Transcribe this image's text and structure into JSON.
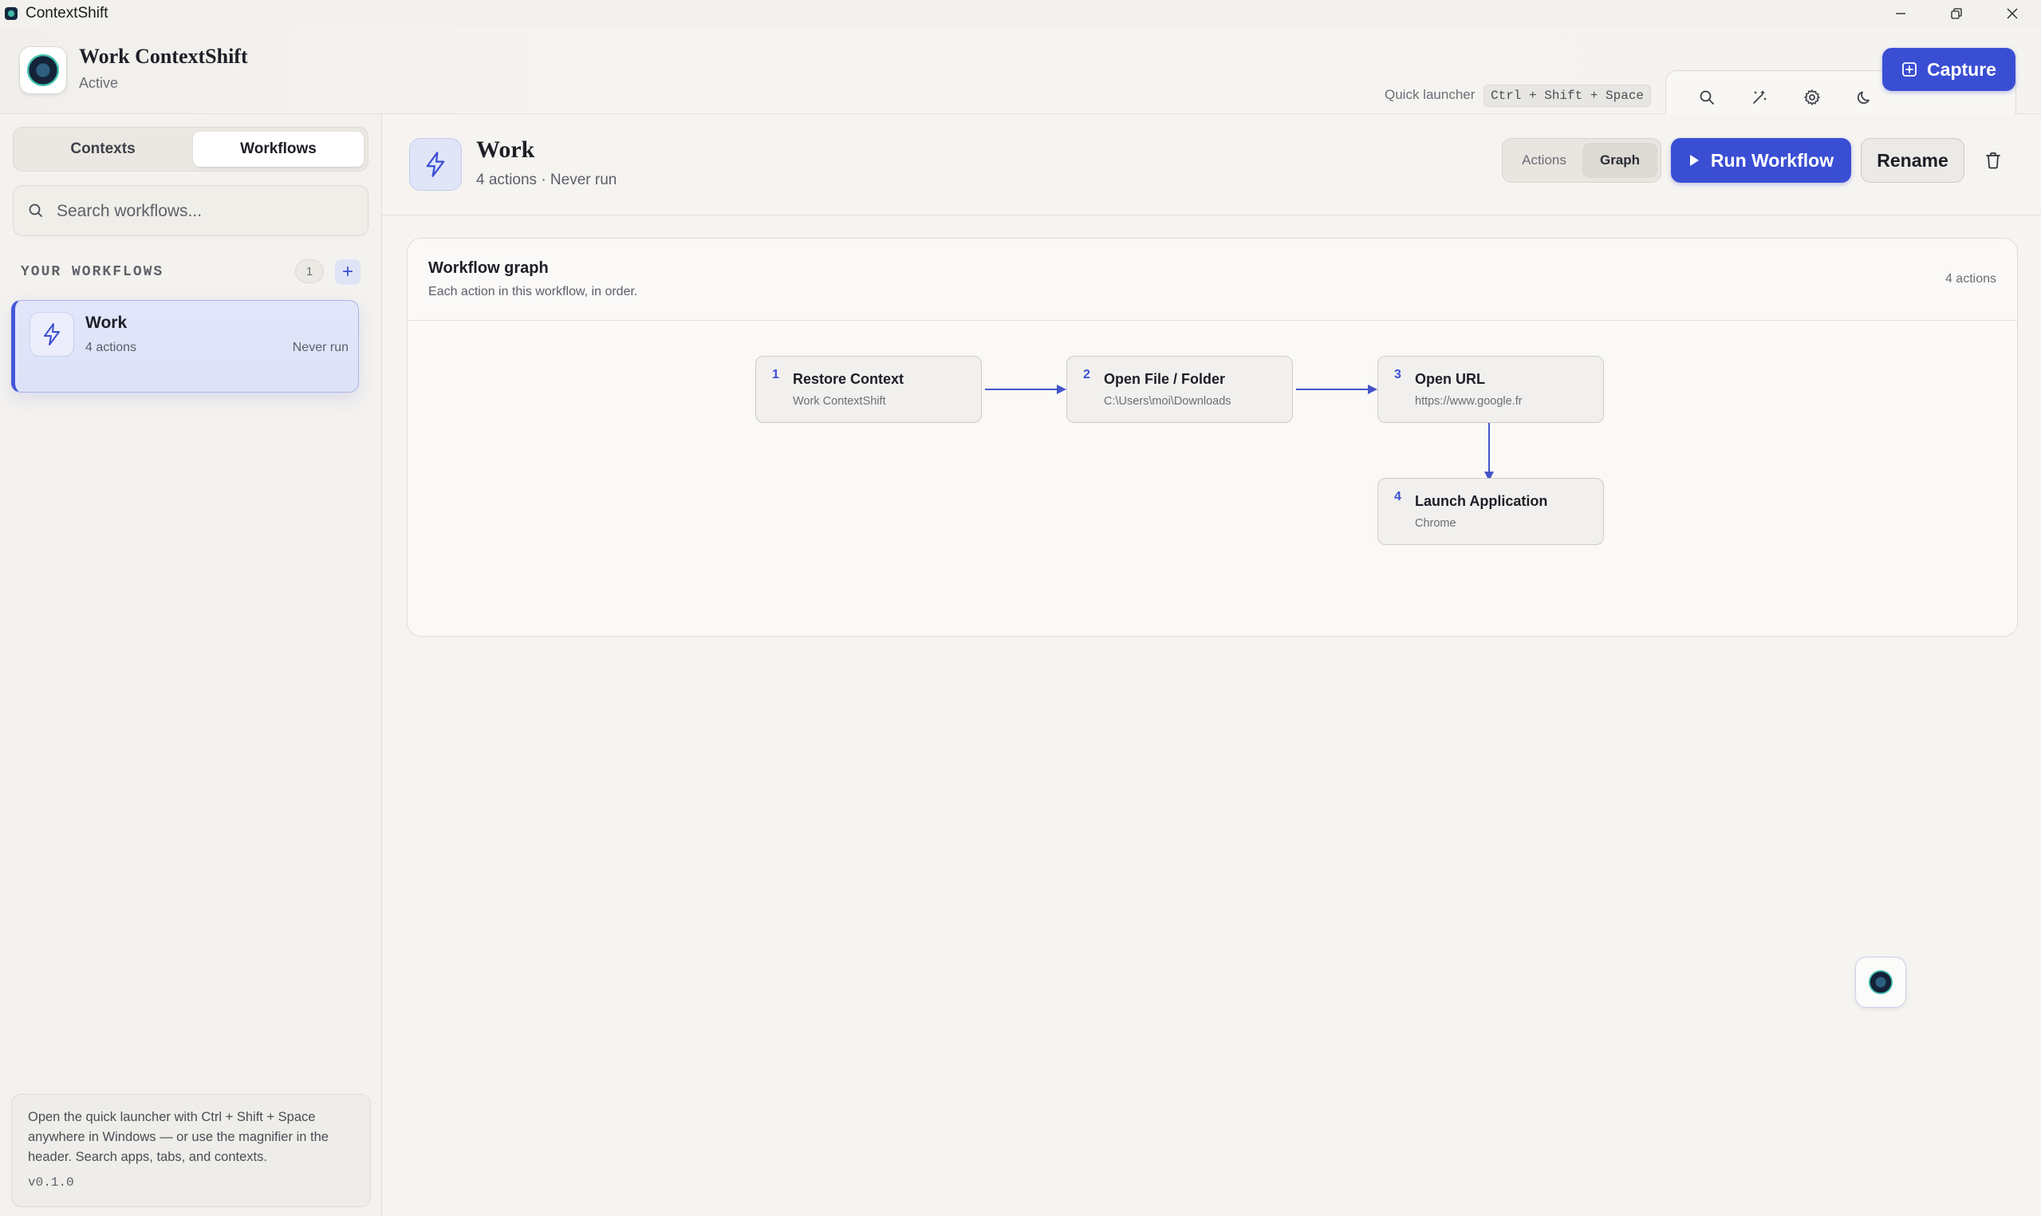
{
  "window": {
    "title": "ContextShift"
  },
  "header": {
    "app_name": "Work ContextShift",
    "status": "Active",
    "quick_launcher_label": "Quick launcher",
    "quick_launcher_shortcut": "Ctrl + Shift + Space",
    "tools": [
      "search-icon",
      "magic-wand-icon",
      "gear-icon",
      "moon-icon"
    ],
    "capture_label": "Capture",
    "accent_color": "#3a4ed4"
  },
  "sidebar": {
    "tabs": [
      {
        "label": "Contexts",
        "active": false
      },
      {
        "label": "Workflows",
        "active": true
      }
    ],
    "search_placeholder": "Search workflows...",
    "section_label": "YOUR WORKFLOWS",
    "count": "1",
    "workflows": [
      {
        "name": "Work",
        "actions": "4 actions",
        "last_run": "Never run",
        "selected": true
      }
    ],
    "help_text": "Open the quick launcher with Ctrl + Shift + Space anywhere in Windows — or use the magnifier in the header. Search apps, tabs, and contexts.",
    "version": "v0.1.0"
  },
  "main": {
    "title": "Work",
    "subtitle": "4 actions · Never run",
    "view_tabs": [
      {
        "label": "Actions",
        "active": false
      },
      {
        "label": "Graph",
        "active": true
      }
    ],
    "run_label": "Run Workflow",
    "rename_label": "Rename",
    "graph": {
      "title": "Workflow graph",
      "subtitle": "Each action in this workflow, in order.",
      "count": "4 actions",
      "nodes": [
        {
          "num": "1",
          "title": "Restore Context",
          "detail": "Work ContextShift"
        },
        {
          "num": "2",
          "title": "Open File / Folder",
          "detail": "C:\\Users\\moi\\Downloads"
        },
        {
          "num": "3",
          "title": "Open URL",
          "detail": "https://www.google.fr"
        },
        {
          "num": "4",
          "title": "Launch Application",
          "detail": "Chrome"
        }
      ]
    }
  }
}
